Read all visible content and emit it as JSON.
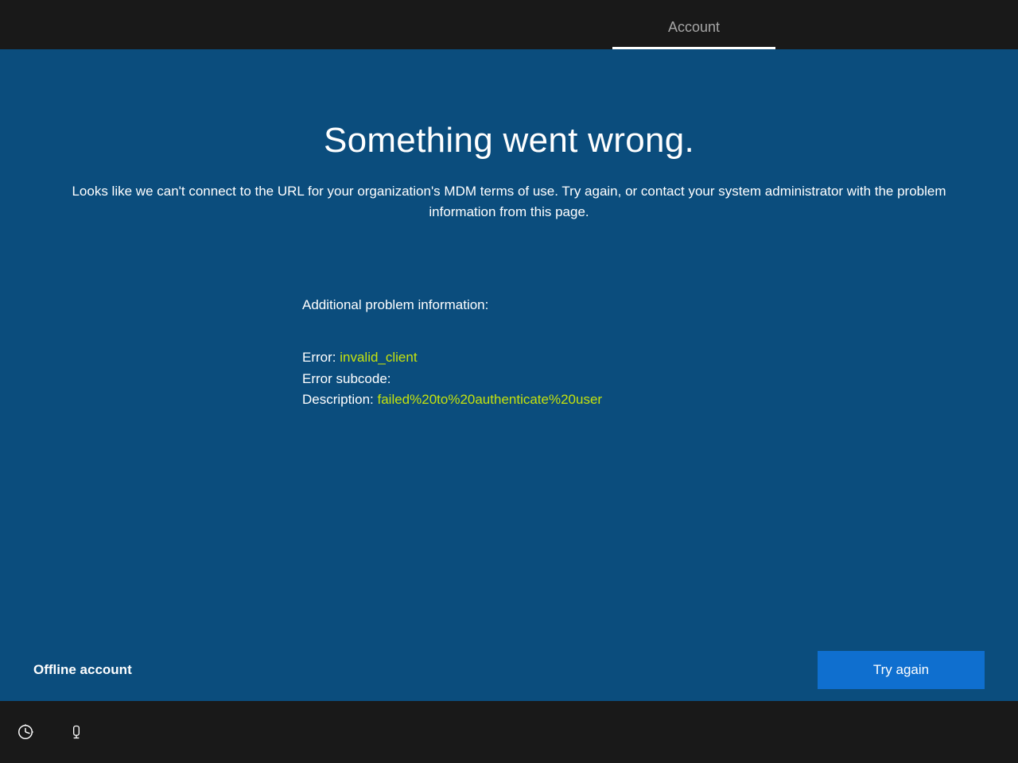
{
  "header": {
    "tab_label": "Account"
  },
  "main": {
    "title": "Something went wrong.",
    "message": "Looks like we can't connect to the URL for your organization's MDM terms of use. Try again, or contact your system administrator with the problem information from this page.",
    "details_heading": "Additional problem information:",
    "error_label": "Error: ",
    "error_value": "invalid_client",
    "subcode_label": "Error subcode:",
    "subcode_value": "",
    "description_label": "Description: ",
    "description_value": "failed%20to%20authenticate%20user"
  },
  "actions": {
    "offline_label": "Offline account",
    "retry_label": "Try again"
  }
}
